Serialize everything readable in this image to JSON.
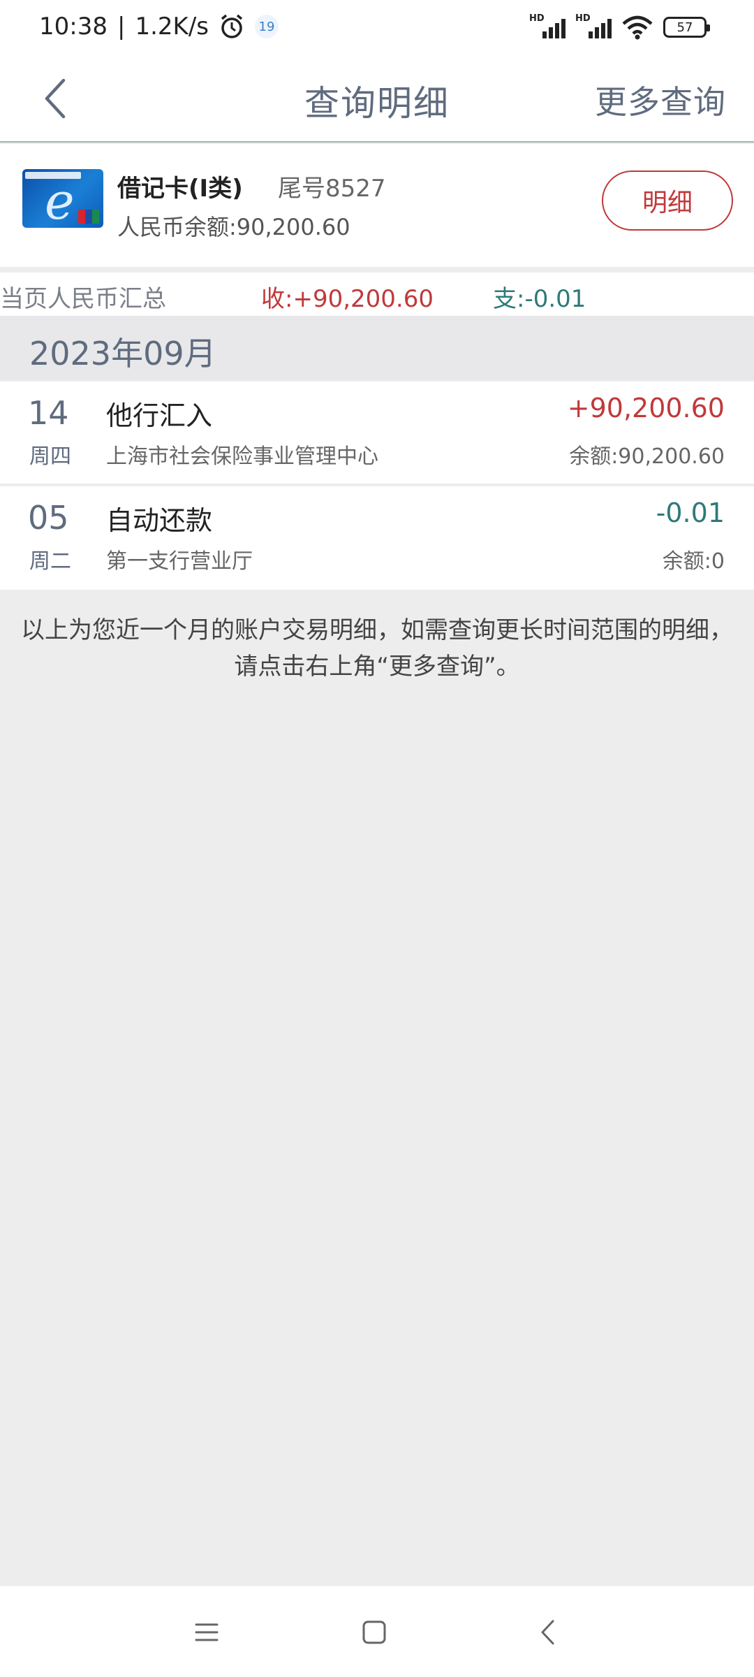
{
  "status_bar": {
    "time": "10:38",
    "separator": "|",
    "net_speed": "1.2K/s",
    "notification_badge": "19",
    "signal1_label": "HD",
    "signal2_label": "HD",
    "battery": "57",
    "icons": [
      "alarm-icon",
      "signal-icon",
      "signal-icon",
      "wifi-icon",
      "battery-icon"
    ]
  },
  "nav": {
    "title": "查询明细",
    "more_query": "更多查询",
    "back_icon": "chevron-left-icon"
  },
  "card": {
    "name": "借记卡(Ⅰ类)",
    "tail": "尾号8527",
    "balance": "人民币余额:90,200.60",
    "detail_button": "明细"
  },
  "summary": {
    "label": "当页人民币汇总",
    "income": "收:+90,200.60",
    "expense": "支:-0.01"
  },
  "month": "2023年09月",
  "transactions": [
    {
      "day": "14",
      "weekday": "周四",
      "type": "他行汇入",
      "party": "上海市社会保险事业管理中心",
      "amount": "+90,200.60",
      "direction": "in",
      "balance": "余额:90,200.60"
    },
    {
      "day": "05",
      "weekday": "周二",
      "type": "自动还款",
      "party": "第一支行营业厅",
      "amount": "-0.01",
      "direction": "out",
      "balance": "余额:0"
    }
  ],
  "note": "以上为您近一个月的账户交易明细，如需查询更长时间范围的明细，请点击右上角“更多查询”。",
  "colors": {
    "income": "#c0393b",
    "expense": "#2e7a78",
    "title": "#5f6b7e",
    "background": "#ededed"
  },
  "system_nav": {
    "icons": [
      "menu-icon",
      "home-icon",
      "back-icon"
    ]
  }
}
